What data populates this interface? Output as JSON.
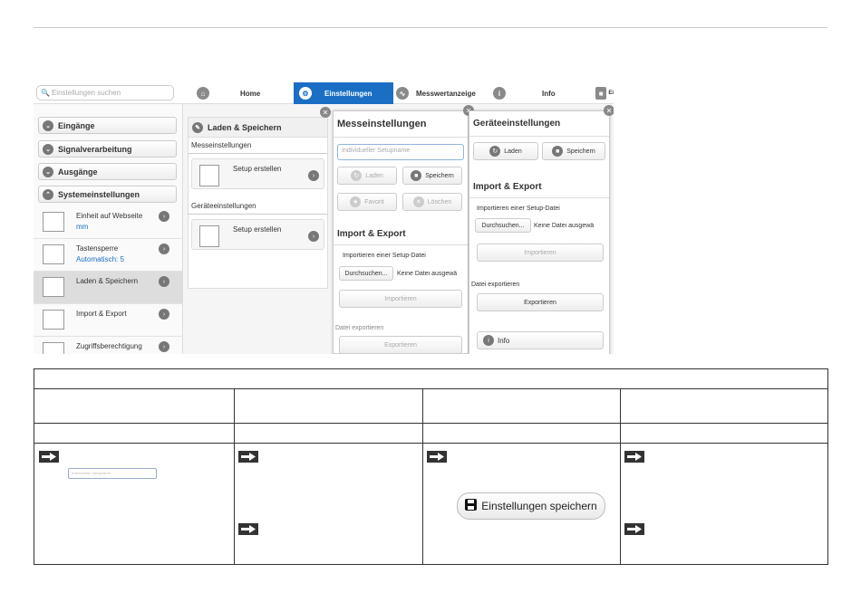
{
  "search": {
    "placeholder": "Einstellungen suchen"
  },
  "tabs": [
    {
      "label": "Home",
      "icon": "home-icon"
    },
    {
      "label": "Einstellungen",
      "icon": "gear-icon"
    },
    {
      "label": "Messwertanzeige",
      "icon": "gauge-icon"
    },
    {
      "label": "Info",
      "icon": "info-icon"
    },
    {
      "label": "Ei",
      "icon": "save-icon"
    }
  ],
  "sidebar": {
    "groups": [
      "Eingänge",
      "Signalverarbeitung",
      "Ausgänge",
      "Systemeinstellungen"
    ],
    "items": [
      {
        "label": "Einheit auf Webseite",
        "value": "mm"
      },
      {
        "label": "Tastensperre",
        "value": "Automatisch: 5"
      },
      {
        "label": "Laden & Speichern",
        "value": ""
      },
      {
        "label": "Import & Export",
        "value": ""
      },
      {
        "label": "Zugriffsberechtigung",
        "value": ""
      }
    ]
  },
  "panel2": {
    "title": "Laden & Speichern",
    "section1": "Messeinstellungen",
    "card1": "Setup erstellen",
    "section2": "Geräteeinstellungen",
    "card2": "Setup erstellen"
  },
  "panel3": {
    "title": "Messeinstellungen",
    "input_placeholder": "Individueller Setupname",
    "btn_load": "Laden",
    "btn_save": "Speichern",
    "btn_fav": "Favorit",
    "btn_delete": "Löschen",
    "import_title": "Import & Export",
    "import_label": "Importieren einer Setup-Datei",
    "browse": "Durchsuchen...",
    "no_file": "Keine Datei ausgewä",
    "import_btn": "Importieren",
    "export_label": "Datei exportieren",
    "export_btn": "Exportieren"
  },
  "panel4": {
    "title": "Geräteeinstellungen",
    "btn_load": "Laden",
    "btn_save": "Speichern",
    "import_title": "Import & Export",
    "import_label": "Importieren einer Setup-Datei",
    "browse": "Durchsuchen...",
    "no_file": "Keine Datei ausgewä",
    "import_btn": "Importieren",
    "export_label": "Datei exportieren",
    "export_btn": "Exportieren",
    "info": "Info"
  },
  "table": {
    "mini_input_placeholder": "Individueller Setupname",
    "save_button": "Einstellungen speichern"
  }
}
